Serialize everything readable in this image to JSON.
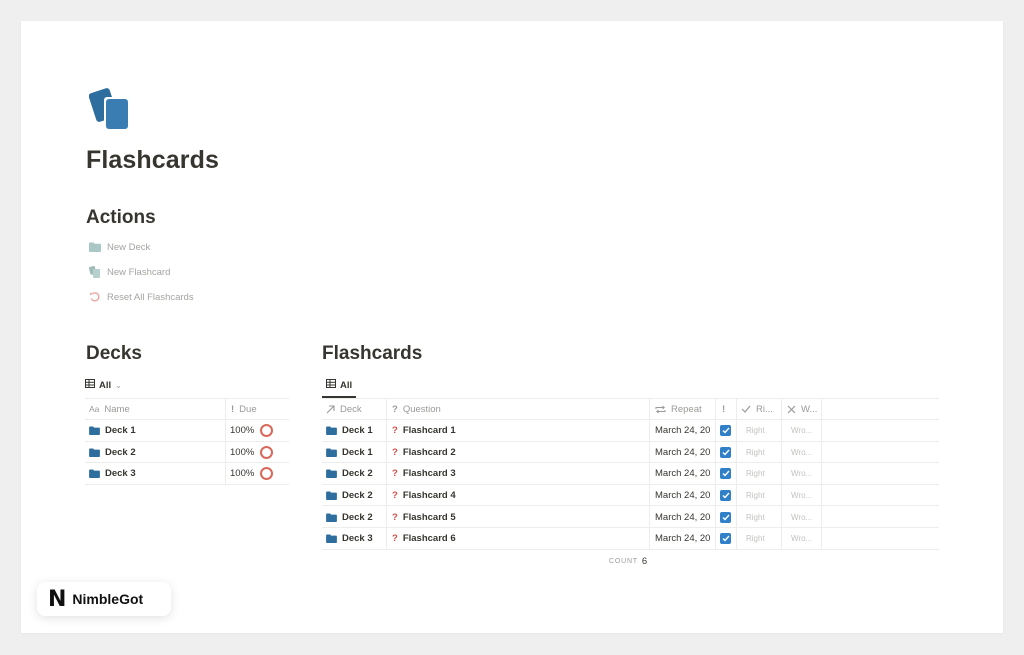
{
  "page": {
    "title": "Flashcards",
    "icon": "cards-icon"
  },
  "actions": {
    "heading": "Actions",
    "items": [
      {
        "label": "New Deck",
        "icon": "folder-icon"
      },
      {
        "label": "New Flashcard",
        "icon": "cards-icon"
      },
      {
        "label": "Reset All Flashcards",
        "icon": "reset-icon"
      }
    ]
  },
  "decks": {
    "heading": "Decks",
    "view": "All",
    "columns": {
      "name": "Name",
      "name_prefix": "Aa",
      "due": "Due"
    },
    "rows": [
      {
        "name": "Deck 1",
        "due": "100%"
      },
      {
        "name": "Deck 2",
        "due": "100%"
      },
      {
        "name": "Deck 3",
        "due": "100%"
      }
    ]
  },
  "flashcards": {
    "heading": "Flashcards",
    "view": "All",
    "columns": {
      "deck": "Deck",
      "question": "Question",
      "repeat": "Repeat",
      "important": "!",
      "right": "Ri...",
      "wrong": "W..."
    },
    "rows": [
      {
        "deck": "Deck 1",
        "question": "Flashcard 1",
        "repeat": "March 24, 20",
        "important": true,
        "right": "Right",
        "wrong": "Wro..."
      },
      {
        "deck": "Deck 1",
        "question": "Flashcard 2",
        "repeat": "March 24, 20",
        "important": true,
        "right": "Right",
        "wrong": "Wro..."
      },
      {
        "deck": "Deck 2",
        "question": "Flashcard 3",
        "repeat": "March 24, 20",
        "important": true,
        "right": "Right",
        "wrong": "Wro..."
      },
      {
        "deck": "Deck 2",
        "question": "Flashcard 4",
        "repeat": "March 24, 20",
        "important": true,
        "right": "Right",
        "wrong": "Wro..."
      },
      {
        "deck": "Deck 2",
        "question": "Flashcard 5",
        "repeat": "March 24, 20",
        "important": true,
        "right": "Right",
        "wrong": "Wro..."
      },
      {
        "deck": "Deck 3",
        "question": "Flashcard 6",
        "repeat": "March 24, 20",
        "important": true,
        "right": "Right",
        "wrong": "Wro..."
      }
    ],
    "count_label": "COUNT",
    "count": "6"
  },
  "brand": {
    "name": "NimbleGot",
    "logo": "N"
  },
  "colors": {
    "accent": "#2f80c8",
    "icon_blue": "#2e6e9e",
    "ring": "#d9685a",
    "question_red": "#d44c47"
  }
}
